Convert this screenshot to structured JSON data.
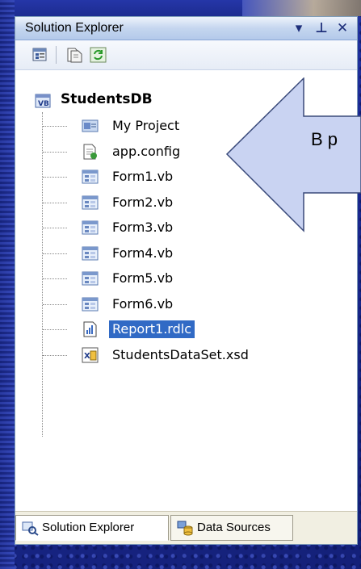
{
  "window": {
    "title": "Solution Explorer",
    "dropdown_glyph": "▾",
    "pin_glyph": "⊥",
    "close_glyph": "✕"
  },
  "toolbar": {
    "items": [
      {
        "name": "properties-icon"
      },
      {
        "name": "show-all-files-icon"
      },
      {
        "name": "refresh-icon"
      }
    ]
  },
  "tree": {
    "root": {
      "label": "StudentsDB",
      "icon": "vb-project-icon"
    },
    "items": [
      {
        "label": "My Project",
        "icon": "my-project-icon",
        "selected": false
      },
      {
        "label": "app.config",
        "icon": "config-file-icon",
        "selected": false
      },
      {
        "label": "Form1.vb",
        "icon": "form-icon",
        "selected": false
      },
      {
        "label": "Form2.vb",
        "icon": "form-icon",
        "selected": false
      },
      {
        "label": "Form3.vb",
        "icon": "form-icon",
        "selected": false
      },
      {
        "label": "Form4.vb",
        "icon": "form-icon",
        "selected": false
      },
      {
        "label": "Form5.vb",
        "icon": "form-icon",
        "selected": false
      },
      {
        "label": "Form6.vb",
        "icon": "form-icon",
        "selected": false
      },
      {
        "label": "Report1.rdlc",
        "icon": "report-icon",
        "selected": true
      },
      {
        "label": "StudentsDataSet.xsd",
        "icon": "dataset-icon",
        "selected": false
      }
    ]
  },
  "tabs": [
    {
      "label": "Solution Explorer",
      "icon": "solution-explorer-icon",
      "active": true
    },
    {
      "label": "Data Sources",
      "icon": "data-sources-icon",
      "active": false
    }
  ],
  "callout": {
    "text": "В р"
  },
  "colors": {
    "selection": "#316ac5",
    "background": "#1a2a8c",
    "arrow_fill": "#c9d3f2"
  }
}
